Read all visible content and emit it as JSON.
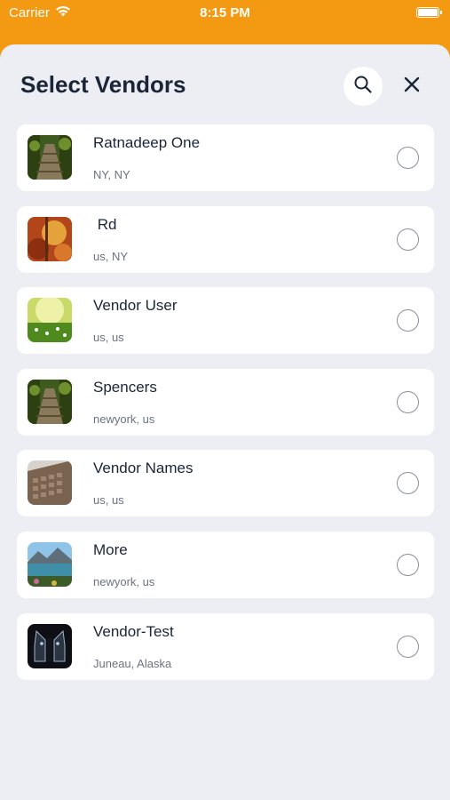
{
  "status_bar": {
    "carrier": "Carrier",
    "time": "8:15 PM"
  },
  "header": {
    "title": "Select Vendors"
  },
  "icons": {
    "search": "search-icon",
    "close": "close-icon",
    "wifi": "wifi-icon",
    "battery": "battery-icon"
  },
  "colors": {
    "accent": "#f49a12",
    "background": "#eceef3",
    "card": "#ffffff",
    "text": "#1b2538",
    "subtext": "#6b7280"
  },
  "vendors": [
    {
      "name": "Ratnadeep One",
      "location": "NY, NY",
      "thumb": "forest-path"
    },
    {
      "name": " Rd",
      "location": "us, NY",
      "thumb": "autumn"
    },
    {
      "name": "Vendor User",
      "location": "us, us",
      "thumb": "meadow"
    },
    {
      "name": "Spencers",
      "location": "newyork, us",
      "thumb": "forest-path"
    },
    {
      "name": "Vendor Names",
      "location": "us, us",
      "thumb": "keyboard"
    },
    {
      "name": "More",
      "location": "newyork, us",
      "thumb": "lake"
    },
    {
      "name": "Vendor-Test",
      "location": "Juneau, Alaska",
      "thumb": "robot"
    }
  ]
}
